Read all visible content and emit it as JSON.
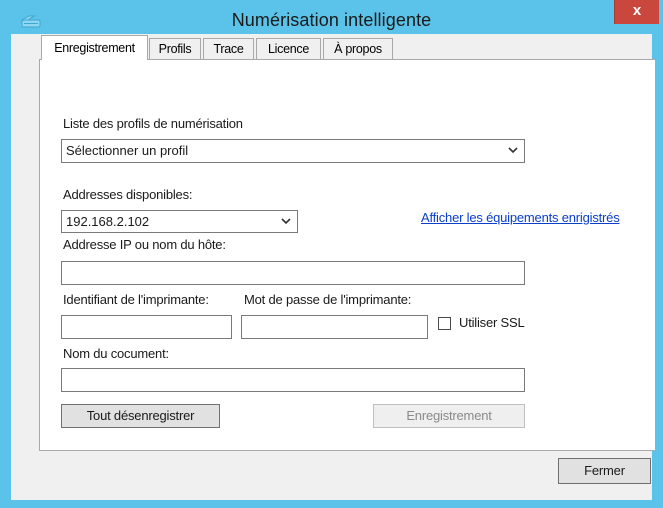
{
  "window": {
    "title": "Numérisation intelligente",
    "close_glyph": "x",
    "app_icon": "scanner-icon",
    "close_color": "#c9473d",
    "titlebar_color": "#5bc2e9"
  },
  "tabs": [
    {
      "label": "Enregistrement",
      "active": true
    },
    {
      "label": "Profils",
      "active": false
    },
    {
      "label": "Trace",
      "active": false
    },
    {
      "label": "Licence",
      "active": false
    },
    {
      "label": "À propos",
      "active": false
    }
  ],
  "profiles": {
    "label": "Liste des profils de numérisation",
    "selected": "Sélectionner un profil"
  },
  "addresses": {
    "label": "Addresses disponibles:",
    "selected": "192.168.2.102"
  },
  "show_devices_link": "Afficher les équipements enrigistrés",
  "host": {
    "label": "Addresse IP ou nom du hôte:",
    "value": ""
  },
  "printer_id": {
    "label": "Identifiant de l'imprimante:",
    "value": ""
  },
  "printer_password": {
    "label": "Mot de passe de l'imprimante:",
    "value": ""
  },
  "ssl": {
    "label": "Utiliser SSL",
    "checked": false
  },
  "document": {
    "label": "Nom du cocument:",
    "value": ""
  },
  "buttons": {
    "unregister_all": "Tout désenregistrer",
    "register": "Enregistrement",
    "close": "Fermer"
  },
  "link_color": "#0a3fc9"
}
